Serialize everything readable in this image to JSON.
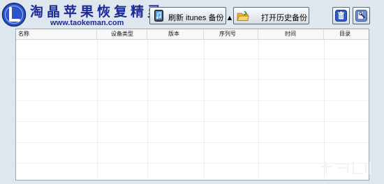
{
  "brand": {
    "title": "淘晶苹果恢复精灵",
    "url": "www.taokeman.com",
    "icon": "taokeman-logo-icon"
  },
  "toolbar": {
    "refresh_label": "刷新 itunes 备份 ▲",
    "refresh_icon": "music-phone-icon",
    "history_label": "打开历史备份",
    "history_icon": "open-folder-icon",
    "delete_icon": "trash-icon",
    "settings_icon": "settings-icon"
  },
  "table": {
    "columns": [
      "名称",
      "设备类型",
      "版本",
      "序列号",
      "时间",
      "目录"
    ],
    "rows": []
  },
  "colors": {
    "background": "#dfe7ee",
    "brand_blue": "#1c2a9a",
    "table_bg": "#ffffff"
  }
}
